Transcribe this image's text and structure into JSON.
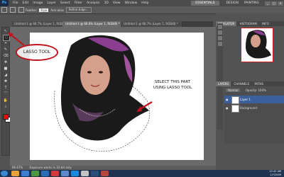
{
  "menubar": {
    "logo": "Ps",
    "menus": [
      "File",
      "Edit",
      "Image",
      "Layer",
      "Select",
      "Filter",
      "Analysis",
      "3D",
      "View",
      "Window",
      "Help"
    ],
    "workspaces": {
      "active": "ESSENTIALS",
      "design": "DESIGN",
      "painting": "PAINTING"
    },
    "window_buttons": [
      "_",
      "□",
      "×"
    ]
  },
  "options_bar": {
    "feather_label": "Feather:",
    "feather_value": "0 px",
    "antialias_label": "Anti-alias",
    "refine_button": "Refine Edge..."
  },
  "document_tabs": [
    {
      "label": "Untitled-1 @ 66.7% (Layer 1, RGB/8) *",
      "active": false
    },
    {
      "label": "Untitled-1 @ 66.6% (Layer 1, RGB/8) *",
      "active": true
    },
    {
      "label": "Untitled-1 @ 66.7% (Layer 1, RGB/8) *",
      "active": false
    }
  ],
  "tools": [
    "↖",
    "◌",
    "⌖",
    "✎",
    "⌫",
    "✚",
    "■",
    "◢",
    "✱",
    "T",
    "⌒",
    "✋",
    "⌕"
  ],
  "swatches": {
    "foreground": "#e01010",
    "background": "#ffffff"
  },
  "annotations": {
    "lasso_label": "LASSO TOOL",
    "instruction_line1": "SELECT THIS PART",
    "instruction_line2": "USING LASSO TOOL"
  },
  "status": {
    "zoom": "66.67%",
    "doc_info": "Exposure works in 32-bit only"
  },
  "navigator": {
    "tabs": [
      "NAVIGATOR",
      "HISTOGRAM",
      "INFO"
    ]
  },
  "layers_panel": {
    "tabs": [
      "LAYERS",
      "CHANNELS",
      "PATHS"
    ],
    "blend_mode": "Normal",
    "opacity": "Opacity: 100%",
    "layers": [
      {
        "name": "Layer 1",
        "selected": true
      },
      {
        "name": "Background",
        "selected": false
      }
    ]
  },
  "taskbar": {
    "time": "12:42 AM",
    "date": "1/7/2009"
  },
  "colors": {
    "accent_red": "#c0121c",
    "taskbar": "#1f3350",
    "selection_blue": "#3a5f9a"
  }
}
